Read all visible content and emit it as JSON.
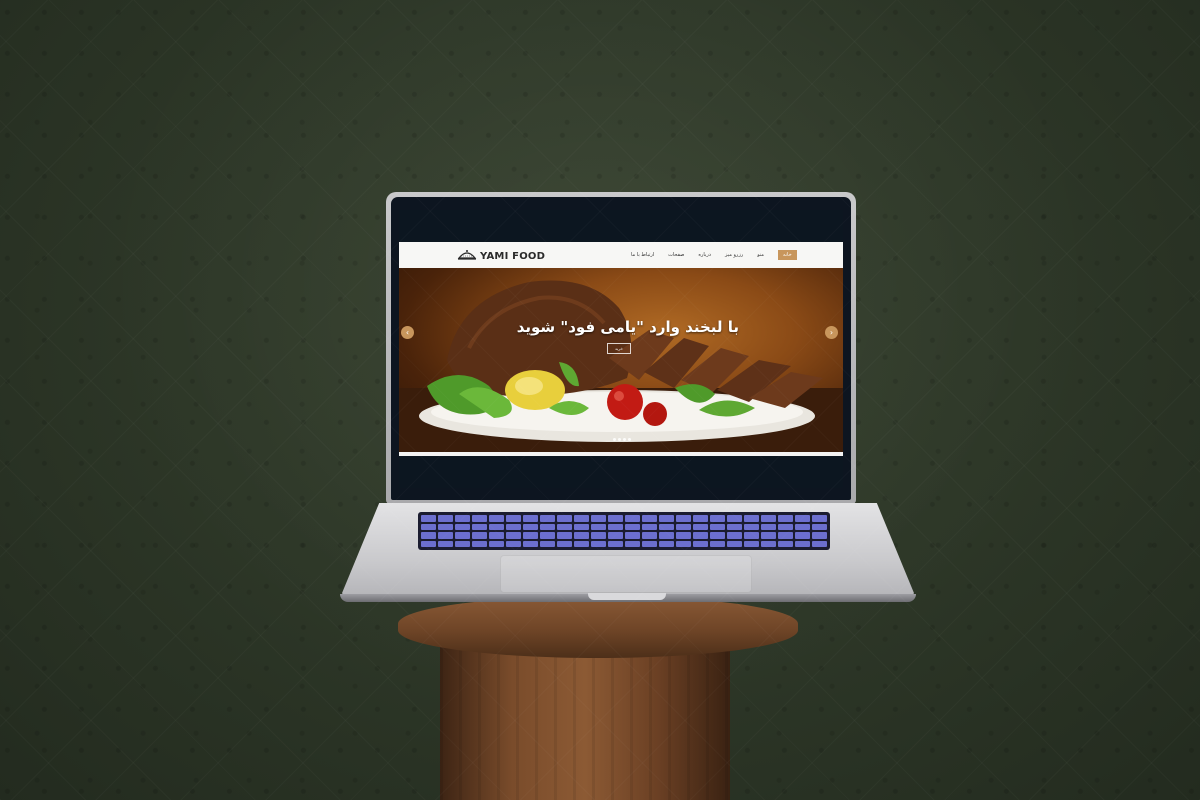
{
  "site": {
    "logo_text": "YAMI FOOD",
    "nav": {
      "items": [
        "خانه",
        "منو",
        "رزرو میز",
        "درباره",
        "صفحات",
        "ارتباط با ما"
      ]
    },
    "hero": {
      "title": "با لبخند وارد \"یامی فود\" شوید",
      "button_label": "خرید",
      "prev_arrow": "‹",
      "next_arrow": "›",
      "slide_count": 4,
      "active_slide": 1
    }
  },
  "icons": {
    "logo": "cloche-icon",
    "prev": "chevron-left-icon",
    "next": "chevron-right-icon"
  },
  "colors": {
    "accent": "#c8965c",
    "wall": "#2e3828",
    "screen_bezel": "#0d1520",
    "keyboard_backlight": "#6c6fcf",
    "pedestal_wood": "#7a4c2b"
  }
}
